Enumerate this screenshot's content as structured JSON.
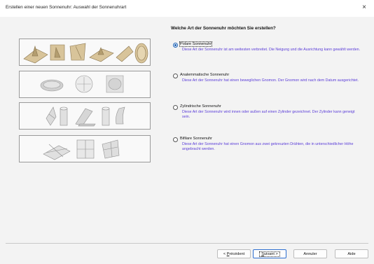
{
  "window": {
    "title": "Erstellen einer neuen Sonnenuhr: Auswahl der Sonnenuhrart",
    "close_glyph": "×"
  },
  "question": "Welche Art der Sonnenuhr möchten Sie erstellen?",
  "options": [
    {
      "label": "Polare Sonnenuhr",
      "selected": true,
      "description": "Diese Art der Sonnenuhr ist am weitesten verbreitet. Die Neigung und die Ausrichtung kann gewählt werden."
    },
    {
      "label": "Analemmatische Sonnenuhr",
      "selected": false,
      "description": "Diese Art der Sonnenuhr hat einen beweglichen Gnomon. Der Gnomon wird nach dem Datum ausgerichtet."
    },
    {
      "label": "Zylindrische Sonnenuhr",
      "selected": false,
      "description": "Diese Art der Sonnenuhr wird innen oder außen auf einen Zylinder gezeichnet. Der Zylinder kann geneigt sein."
    },
    {
      "label": "Bifilare Sonnenuhr",
      "selected": false,
      "description": "Diese Art der Sonnenuhr hat einen Gnomon aus zwei gekreuzten Drähten, die in unterschiedlicher Höhe angebracht werden."
    }
  ],
  "buttons": {
    "previous": {
      "prefix": "< ",
      "mnemonic": "P",
      "rest": "récédent"
    },
    "next": {
      "mnemonic": "S",
      "rest": "uivant",
      "suffix": " >"
    },
    "cancel": "Annuler",
    "help": "Aide"
  },
  "colors": {
    "description_text": "#5a3cd8",
    "selected_radio": "#1a5fb4",
    "default_button_border": "#2f6fd0",
    "dial_tan": "#d8c49a"
  }
}
